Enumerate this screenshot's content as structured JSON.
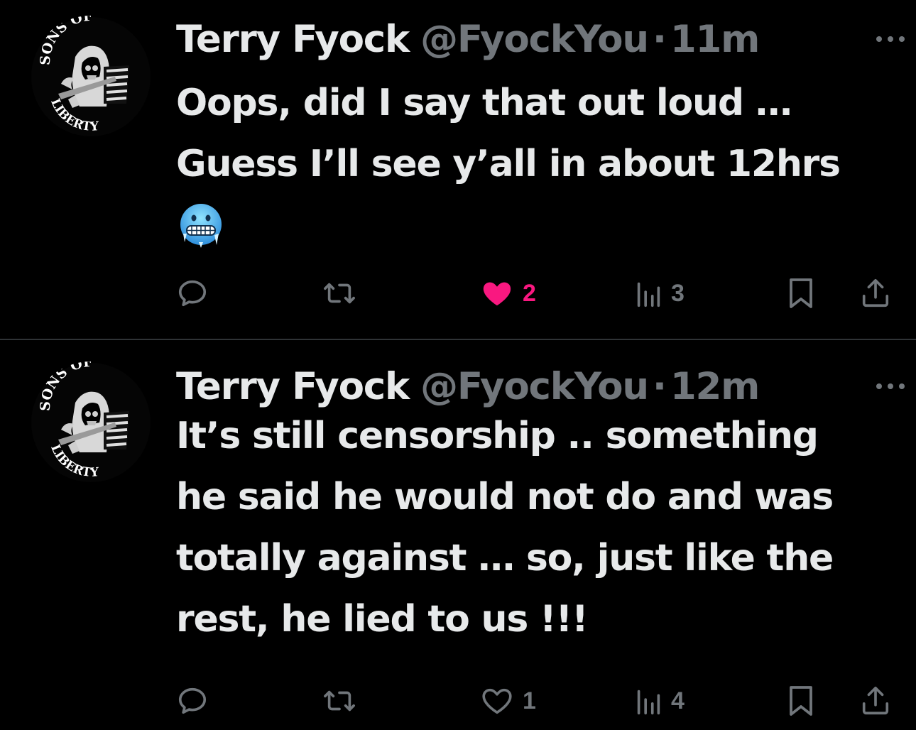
{
  "tweets": [
    {
      "author": {
        "name": "Terry Fyock",
        "handle": "@FyockYou",
        "avatar_icon": "sons-of-liberty-reaper-logo",
        "avatar_text_top": "SONS OF",
        "avatar_text_bottom": "LIBERTY"
      },
      "separator": "·",
      "time": "11m",
      "text": "Oops, did I say that out loud …\nGuess I’ll see y’all in about 12hrs",
      "emoji": "cold-face-emoji",
      "actions": {
        "reply_icon": "reply-icon",
        "retweet_icon": "retweet-icon",
        "like_icon": "heart-filled-icon",
        "like_count": "2",
        "liked": true,
        "views_icon": "views-icon",
        "views_count": "3",
        "bookmark_icon": "bookmark-icon",
        "share_icon": "share-icon"
      }
    },
    {
      "author": {
        "name": "Terry Fyock",
        "handle": "@FyockYou",
        "avatar_icon": "sons-of-liberty-reaper-logo",
        "avatar_text_top": "SONS OF",
        "avatar_text_bottom": "LIBERTY"
      },
      "separator": "·",
      "time": "12m",
      "text": "It’s still censorship .. something\nhe said he would not do and was\ntotally against … so, just like the\nrest, he lied to us !!!",
      "actions": {
        "reply_icon": "reply-icon",
        "retweet_icon": "retweet-icon",
        "like_icon": "heart-outline-icon",
        "like_count": "1",
        "liked": false,
        "views_icon": "views-icon",
        "views_count": "4",
        "bookmark_icon": "bookmark-icon",
        "share_icon": "share-icon"
      }
    }
  ],
  "colors": {
    "background": "#000000",
    "text_primary": "#e7e9ea",
    "text_secondary": "#71767b",
    "like_active": "#f91880",
    "divider": "#2f3336"
  }
}
